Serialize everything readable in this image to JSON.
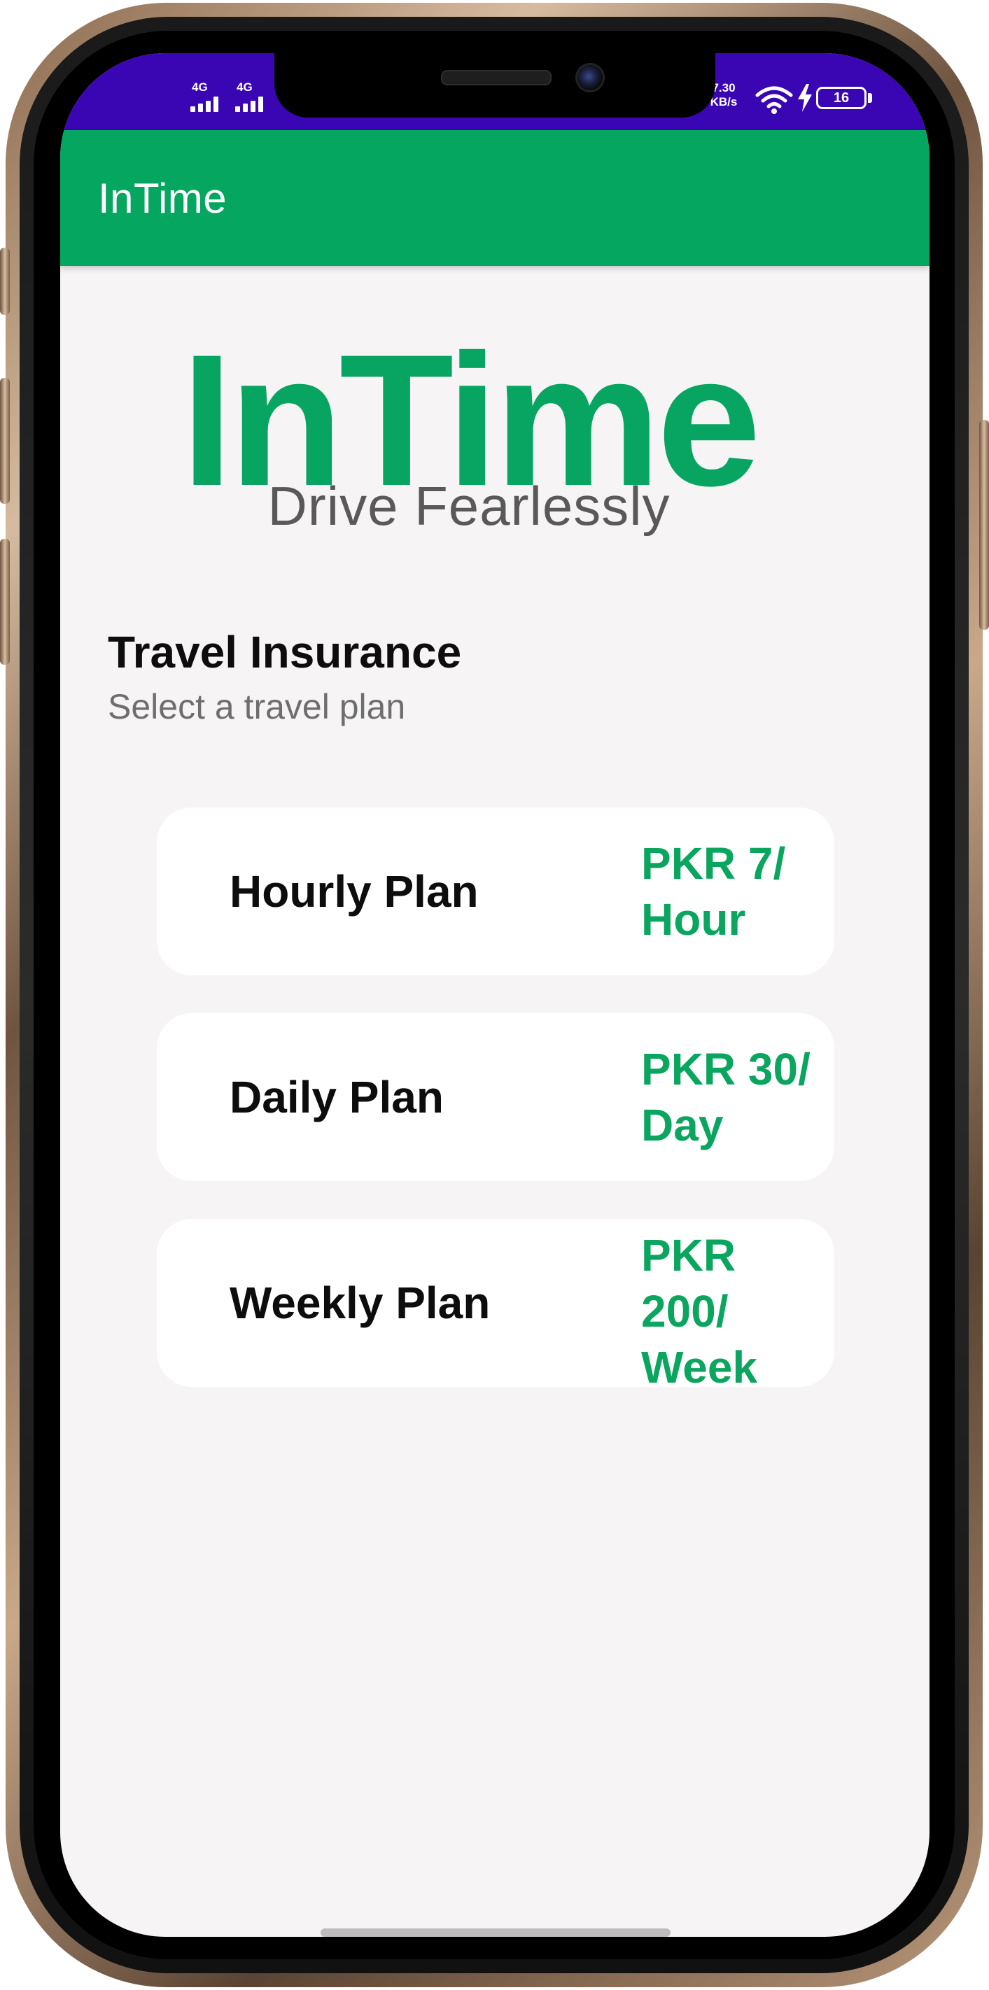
{
  "status_bar": {
    "sim1_label": "4G",
    "sim2_label": "4G",
    "net_speed_value": "7.30",
    "net_speed_unit": "KB/s",
    "battery_level": "16",
    "bg_color": "#3a06b4"
  },
  "app_bar": {
    "title": "InTime",
    "color": "#05a660"
  },
  "logo": {
    "brand": "InTime",
    "tagline": "Drive Fearlessly",
    "brand_color": "#07a561"
  },
  "section": {
    "title": "Travel Insurance",
    "subtitle": "Select a travel plan"
  },
  "plans": [
    {
      "name": "Hourly Plan",
      "price": "PKR 7/ Hour"
    },
    {
      "name": "Daily Plan",
      "price": "PKR 30/ Day"
    },
    {
      "name": "Weekly Plan",
      "price": "PKR 200/ Week"
    }
  ],
  "icons": [
    "signal-icon",
    "wifi-icon",
    "charging-bolt-icon",
    "battery-icon"
  ]
}
